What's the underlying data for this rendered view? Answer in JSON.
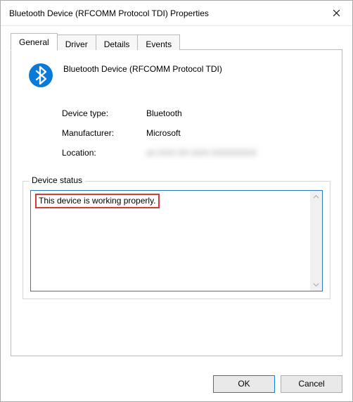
{
  "window": {
    "title": "Bluetooth Device (RFCOMM Protocol TDI) Properties"
  },
  "tabs": [
    {
      "label": "General"
    },
    {
      "label": "Driver"
    },
    {
      "label": "Details"
    },
    {
      "label": "Events"
    }
  ],
  "general": {
    "device_name": "Bluetooth Device (RFCOMM Protocol TDI)",
    "rows": {
      "device_type_label": "Device type:",
      "device_type_value": "Bluetooth",
      "manufacturer_label": "Manufacturer:",
      "manufacturer_value": "Microsoft",
      "location_label": "Location:",
      "location_value": "on XXX-XX-XXX-XXXXXXXX"
    },
    "status_legend": "Device status",
    "status_text": "This device is working properly."
  },
  "buttons": {
    "ok": "OK",
    "cancel": "Cancel"
  }
}
